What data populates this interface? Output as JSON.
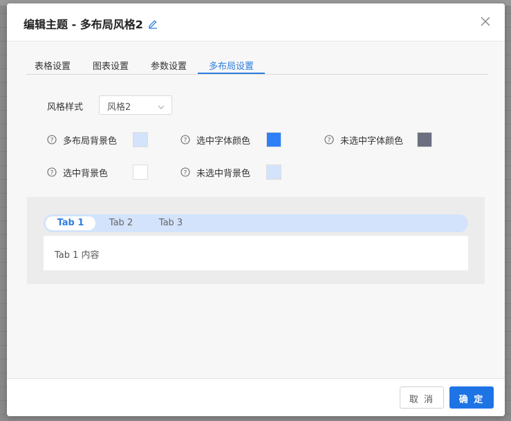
{
  "dialog": {
    "title": "编辑主题 - 多布局风格2"
  },
  "tabs": [
    {
      "label": "表格设置",
      "active": false
    },
    {
      "label": "图表设置",
      "active": false
    },
    {
      "label": "参数设置",
      "active": false
    },
    {
      "label": "多布局设置",
      "active": true
    }
  ],
  "style": {
    "label": "风格样式",
    "selected": "风格2"
  },
  "colors": {
    "layout_bg": {
      "label": "多布局背景色",
      "value": "#d3e3fb"
    },
    "selected_font": {
      "label": "选中字体颜色",
      "value": "#2f80f7"
    },
    "unselected_font": {
      "label": "未选中字体颜色",
      "value": "#6b6f80"
    },
    "selected_bg": {
      "label": "选中背景色",
      "value": "#ffffff"
    },
    "unselected_bg": {
      "label": "未选中背景色",
      "value": "#d3e3fb"
    }
  },
  "preview": {
    "tabs": [
      "Tab 1",
      "Tab 2",
      "Tab 3"
    ],
    "content": "Tab 1 内容"
  },
  "footer": {
    "cancel_label": "取 消",
    "ok_label": "确 定"
  }
}
